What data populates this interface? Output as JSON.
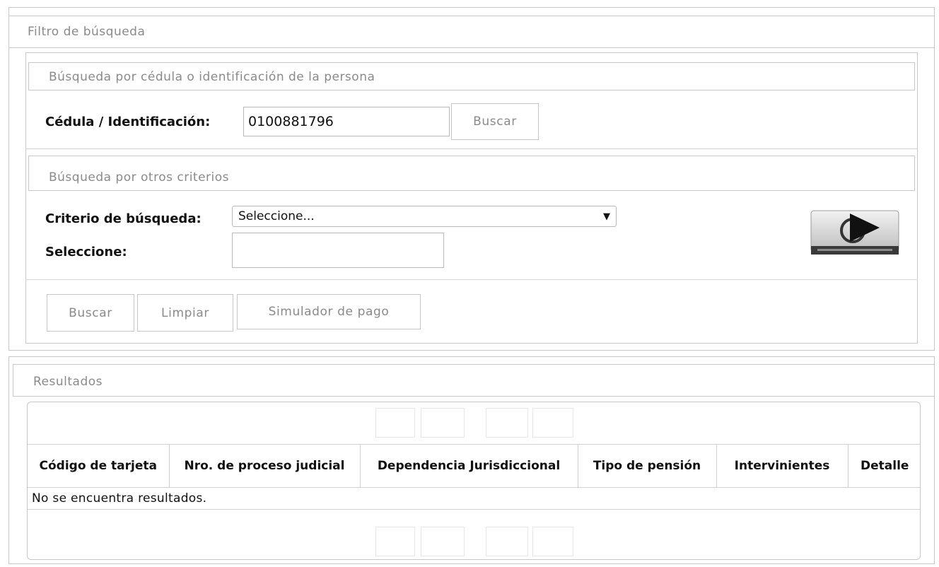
{
  "filter": {
    "title": "Filtro de búsqueda",
    "by_id": {
      "title": "Búsqueda por cédula o identificación de la persona",
      "field_label": "Cédula / Identificación:",
      "field_value": "0100881796",
      "search_button": "Buscar"
    },
    "by_other": {
      "title": "Búsqueda por otros criterios",
      "criteria_label": "Criterio de búsqueda:",
      "criteria_value": "Seleccione...",
      "criteria_caret": "▼",
      "select_label": "Seleccione:",
      "select_value": ""
    },
    "actions": {
      "search": "Buscar",
      "clear": "Limpiar",
      "simulator": "Simulador de pago"
    }
  },
  "results": {
    "title": "Resultados",
    "columns": [
      "Código de tarjeta",
      "Nro. de proceso judicial",
      "Dependencia Jurisdiccional",
      "Tipo de pensión",
      "Intervinientes",
      "Detalle"
    ],
    "empty_message": "No se encuentra resultados."
  },
  "video_icon": "play-video-icon"
}
